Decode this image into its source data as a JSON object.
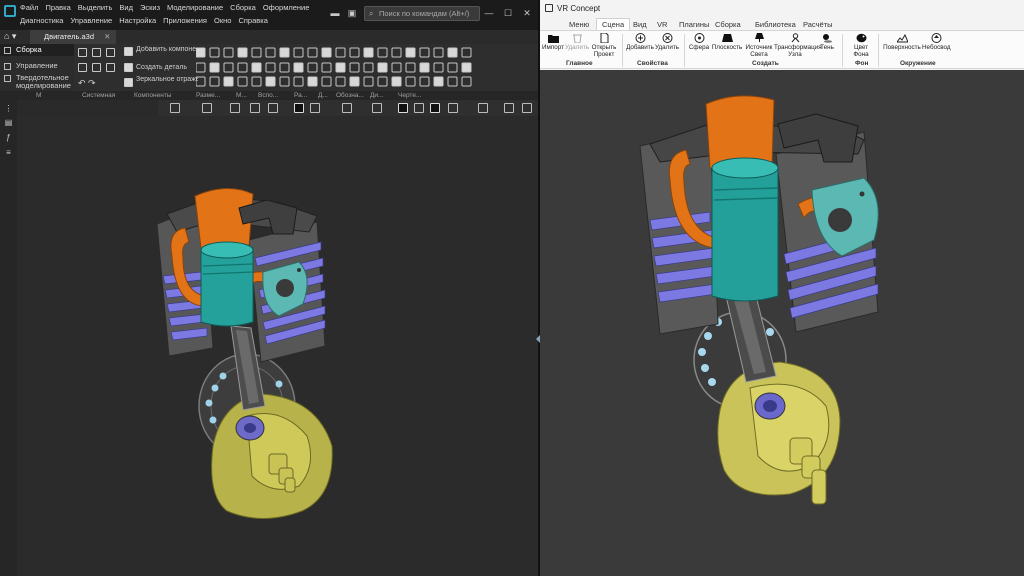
{
  "kompas": {
    "menu_row1": [
      "Файл",
      "Правка",
      "Выделить",
      "Вид",
      "Эскиз",
      "Моделирование",
      "Сборка",
      "Оформление"
    ],
    "menu_row2": [
      "Диагностика",
      "Управление",
      "Настройка",
      "Приложения",
      "Окно",
      "Справка"
    ],
    "search_placeholder": "Поиск по командам (Alt+/)",
    "document_tab": "Двигатель.a3d",
    "sidebar": [
      "Сборка",
      "Управление",
      "Твердотельное моделирование"
    ],
    "ribbon": {
      "add_component": "Добавить компонент из...",
      "create_part": "Создать деталь",
      "mirror_component": "Зеркальное отражение ко..."
    },
    "group_labels": [
      "Системная",
      "Компоненты",
      "Разме...",
      "М...",
      "Вспо...",
      "Ра...",
      "Д...",
      "Обозна...",
      "Ди...",
      "Черте..."
    ],
    "group_marker_m": "М"
  },
  "vr": {
    "title": "VR Concept",
    "tabs": [
      "Меню",
      "Сцена",
      "Вид",
      "VR",
      "Плагины",
      "Сборка",
      "Библиотека",
      "Расчёты"
    ],
    "active_tab": "Сцена",
    "buttons": {
      "import": "Импорт",
      "delete": "Удалить",
      "open_project": "Открыть Проект",
      "add": "Добавить",
      "delete2": "Удалить",
      "sphere": "Сфера",
      "plane": "Плоскость",
      "light_source": "Источник Света",
      "transform_nodes": "Трансформация Узла",
      "shadow": "Тень",
      "bg_color": "Цвет Фона",
      "surface": "Поверхность",
      "skybox": "Небосвод"
    },
    "groups": {
      "main": "Главное",
      "properties": "Свойства",
      "create": "Создать",
      "background": "Фон",
      "environment": "Окружение"
    }
  },
  "colors": {
    "kompas_bg": "#2b2b2b",
    "vr_viewport_bg": "#3a3a3a",
    "piston": "#2aa7a0",
    "cylinder_top": "#e87a1c",
    "fins": "#7a7ae6",
    "crankshaft": "#c8c24e",
    "gasket": "#5bbcb6",
    "housing": "#555555"
  }
}
